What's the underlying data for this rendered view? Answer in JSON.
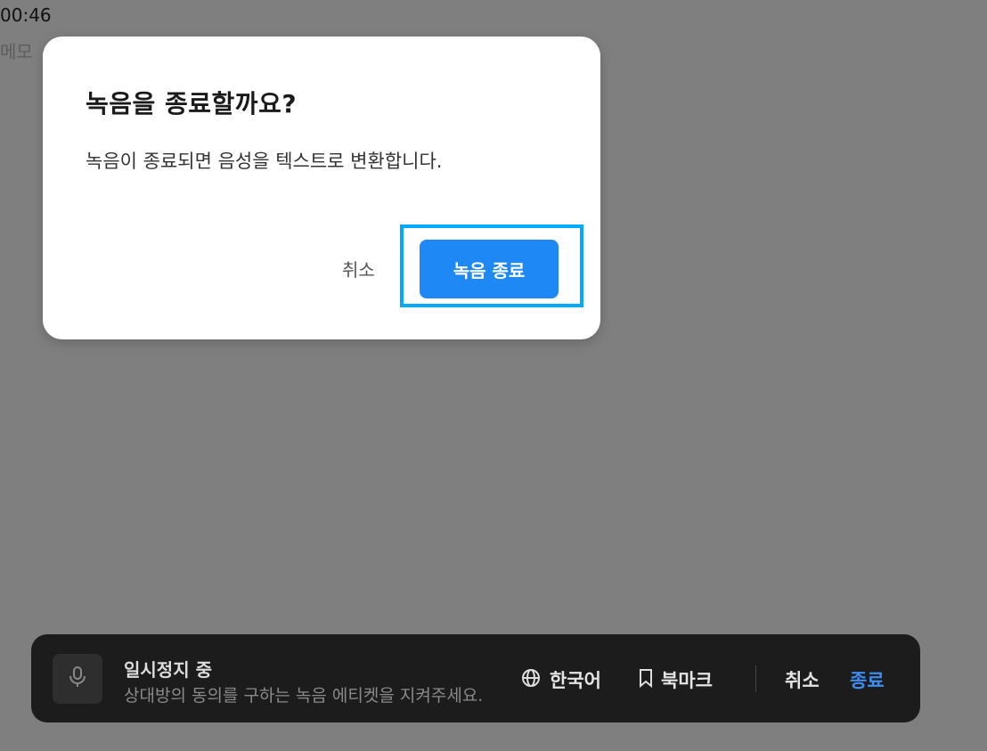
{
  "background": {
    "time": "00:46",
    "memo": "메모"
  },
  "dialog": {
    "title": "녹음을 종료할까요?",
    "message": "녹음이 종료되면 음성을 텍스트로 변환합니다.",
    "cancel_label": "취소",
    "confirm_label": "녹음 종료",
    "confirm_color": "#1e88f5",
    "highlight_color": "#00aaff"
  },
  "recording_bar": {
    "icon": "microphone-icon",
    "status": "일시정지 중",
    "hint": "상대방의 동의를 구하는 녹음 에티켓을 지켜주세요.",
    "language_icon": "globe-icon",
    "language_label": "한국어",
    "bookmark_icon": "bookmark-icon",
    "bookmark_label": "북마크",
    "cancel_label": "취소",
    "end_label": "종료",
    "end_color": "#3d8ef0"
  }
}
